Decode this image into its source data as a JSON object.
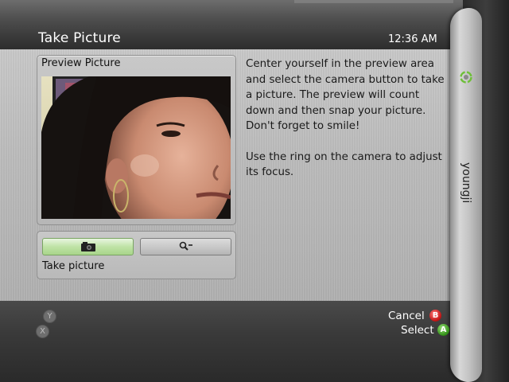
{
  "header": {
    "title": "Take Picture",
    "time": "12:36  AM"
  },
  "preview": {
    "label": "Preview Picture"
  },
  "buttons": {
    "camera_icon": "camera-icon",
    "zoom_icon": "zoom-out-icon",
    "caption": "Take picture"
  },
  "instructions": {
    "paragraph1": "Center yourself in the preview area and select the camera button to take a picture. The preview will count down and then snap your picture. Don't forget to smile!",
    "paragraph2": "Use the ring on the camera to adjust its focus."
  },
  "side_tab": {
    "label": "youngji",
    "icon": "xbox-ring-icon"
  },
  "controls": {
    "cancel_label": "Cancel",
    "cancel_button": "B",
    "select_label": "Select",
    "select_button": "A",
    "y_button": "Y",
    "x_button": "X"
  },
  "colors": {
    "accent_green": "#a8d58a",
    "b_button_red": "#c01010",
    "a_button_green": "#2f8d15"
  }
}
